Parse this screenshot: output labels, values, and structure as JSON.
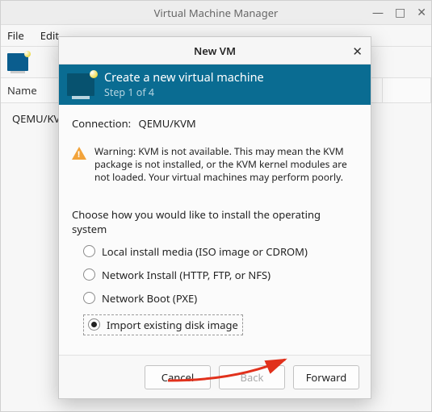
{
  "main_window": {
    "title": "Virtual Machine Manager",
    "menubar": {
      "file": "File",
      "edit": "Edit"
    },
    "columns": {
      "name": "Name"
    },
    "rows": [
      {
        "name": "QEMU/KVM"
      }
    ]
  },
  "dialog": {
    "title": "New VM",
    "banner": {
      "title": "Create a new virtual machine",
      "step": "Step 1 of 4"
    },
    "connection": {
      "label": "Connection:",
      "value": "QEMU/KVM"
    },
    "warning": "Warning: KVM is not available. This may mean the KVM package is not installed, or the KVM kernel modules are not loaded. Your virtual machines may perform poorly.",
    "choose_label": "Choose how you would like to install the operating system",
    "options": {
      "local": "Local install media (ISO image or CDROM)",
      "network": "Network Install (HTTP, FTP, or NFS)",
      "netboot": "Network Boot (PXE)",
      "import": "Import existing disk image"
    },
    "selected": "import",
    "buttons": {
      "cancel": "Cancel",
      "back": "Back",
      "forward": "Forward"
    }
  },
  "colors": {
    "banner": "#0a6c92",
    "arrow": "#e1311c"
  }
}
